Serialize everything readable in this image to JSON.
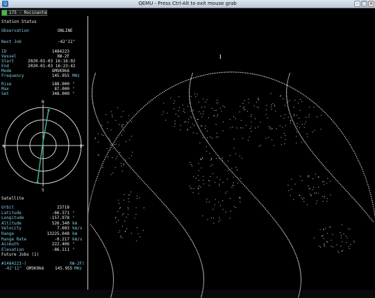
{
  "window": {
    "title": "QEMU - Press Ctrl-Alt to exit mouse grab",
    "app_icon": "qemu-icon"
  },
  "header": {
    "text": "175 - Rocinante"
  },
  "station": {
    "heading": "Station Status",
    "observation_label": "Observation",
    "observation_value": "ONLINE",
    "next_job_label": "Next Job",
    "next_job_value": "-42'11\""
  },
  "job": {
    "rows": [
      {
        "label": "ID",
        "value": "1484223",
        "unit": ""
      },
      {
        "label": "Vessel",
        "value": "XW-2F",
        "unit": ""
      },
      {
        "label": "Start",
        "value": "2020-01-03 16:16:02",
        "unit": ""
      },
      {
        "label": "End",
        "value": "2020-01-03 16:23:42",
        "unit": ""
      },
      {
        "label": "Mode",
        "value": "GMSK9k6",
        "unit": ""
      },
      {
        "label": "Frequency",
        "value": "145.955",
        "unit": "MHz"
      }
    ]
  },
  "passinfo": {
    "rows": [
      {
        "label": "Rise",
        "value": "188.000",
        "unit": "°"
      },
      {
        "label": "Max",
        "value": "87.000",
        "unit": "°"
      },
      {
        "label": "Set",
        "value": "348.000",
        "unit": "°"
      }
    ]
  },
  "polar": {
    "n": "N",
    "e": "E",
    "s": "S",
    "w": "W"
  },
  "satellite": {
    "heading": "Satellite",
    "rows": [
      {
        "label": "Orbit",
        "value": "23718",
        "unit": ""
      },
      {
        "label": "Latitude",
        "value": "-66.371",
        "unit": "°"
      },
      {
        "label": "Longitude",
        "value": "-157.978",
        "unit": "°"
      },
      {
        "label": "Altitude",
        "value": "526.340",
        "unit": "km"
      },
      {
        "label": "Velocity",
        "value": "7.603",
        "unit": "km/s"
      },
      {
        "label": "Range",
        "value": "13225.048",
        "unit": "km"
      },
      {
        "label": "Range Rate",
        "value": "-0.217",
        "unit": "km/s"
      },
      {
        "label": "Azimuth",
        "value": "222.406",
        "unit": "°"
      },
      {
        "label": "Elevation",
        "value": "-86.111",
        "unit": "°"
      }
    ]
  },
  "future": {
    "heading": "Future Jobs (1)",
    "id": "#1484223-(",
    "vessel": "XW-2F)",
    "time": "-42'11\"",
    "mode": "GMSK9k6",
    "freq": "145.955",
    "freq_unit": "MHz"
  },
  "colors": {
    "label": "#7fcbe3",
    "value": "#f0f0f0",
    "led": "#36c23a",
    "track": "#e6e6e6",
    "land": "#9ec9a8",
    "polar_path": "#3fb09c"
  }
}
